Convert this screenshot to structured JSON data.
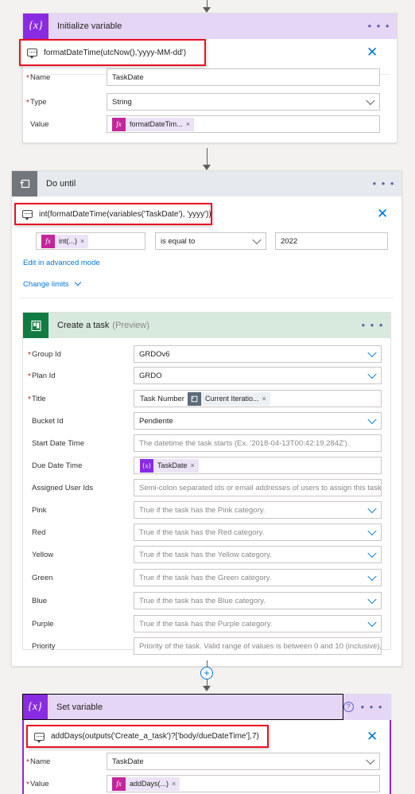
{
  "app": {
    "name": "Power Automate flow designer"
  },
  "steps": [
    {
      "id": "initialize-variable",
      "title": "Initialize variable",
      "subtitle": "",
      "icon": "variable-icon",
      "icon_glyph": "{x}",
      "header_color": "#e5d6f5",
      "icon_color": "#8a2be2",
      "formula_tooltip": "formatDateTime(utcNow(),'yyyy-MM-dd')",
      "params": [
        {
          "label": "Name",
          "required": true,
          "value": "TaskDate",
          "kind": "text"
        },
        {
          "label": "Type",
          "required": true,
          "value": "String",
          "kind": "dropdown"
        },
        {
          "label": "Value",
          "required": false,
          "value": "formatDateTim...",
          "kind": "token-fx"
        }
      ]
    },
    {
      "id": "do-until",
      "title": "Do until",
      "subtitle": "",
      "icon": "do-until-loop-icon",
      "header_color": "#e6eaef",
      "icon_color": "#72777e",
      "formula_tooltip": "int(formatDateTime(variables('TaskDate'), 'yyyy'))",
      "condition": {
        "left_token": "int(...)",
        "operator": "is equal to",
        "right_value": "2022"
      },
      "links": [
        {
          "label": "Edit in advanced mode",
          "chevron": false
        },
        {
          "label": "Change limits",
          "chevron": true
        }
      ]
    },
    {
      "id": "create-a-task",
      "title": "Create a task",
      "subtitle": "(Preview)",
      "icon": "planner-icon",
      "header_color": "#d8e9de",
      "icon_color": "#107c41",
      "params": [
        {
          "label": "Group Id",
          "required": true,
          "value": "GRDOv6",
          "kind": "dropdown",
          "placeholder": false
        },
        {
          "label": "Plan Id",
          "required": true,
          "value": "GRDO",
          "kind": "dropdown",
          "placeholder": false
        },
        {
          "label": "Title",
          "required": true,
          "value": "Task Number",
          "token": "Current Iteratio...",
          "kind": "text-plus-token"
        },
        {
          "label": "Bucket Id",
          "required": false,
          "value": "Pendiente",
          "kind": "dropdown",
          "placeholder": false
        },
        {
          "label": "Start Date Time",
          "required": false,
          "value": "The datetime the task starts (Ex. '2018-04-13T00:42:19.284Z').",
          "kind": "text",
          "placeholder": true
        },
        {
          "label": "Due Date Time",
          "required": false,
          "value": "TaskDate",
          "kind": "token-var"
        },
        {
          "label": "Assigned User Ids",
          "required": false,
          "value": "Semi-colon separated ids or email addresses of users to assign this task to.",
          "kind": "text",
          "placeholder": true
        },
        {
          "label": "Pink",
          "required": false,
          "value": "True if the task has the Pink category.",
          "kind": "dropdown",
          "placeholder": true
        },
        {
          "label": "Red",
          "required": false,
          "value": "True if the task has the Red category.",
          "kind": "dropdown",
          "placeholder": true
        },
        {
          "label": "Yellow",
          "required": false,
          "value": "True if the task has the Yellow category.",
          "kind": "dropdown",
          "placeholder": true
        },
        {
          "label": "Green",
          "required": false,
          "value": "True if the task has the Green category.",
          "kind": "dropdown",
          "placeholder": true
        },
        {
          "label": "Blue",
          "required": false,
          "value": "True if the task has the Blue category.",
          "kind": "dropdown",
          "placeholder": true
        },
        {
          "label": "Purple",
          "required": false,
          "value": "True if the task has the Purple category.",
          "kind": "dropdown",
          "placeholder": true
        },
        {
          "label": "Priority",
          "required": false,
          "value": "Priority of the task. Valid range of values is between 0 and 10 (inclusive), with in",
          "kind": "text",
          "placeholder": true
        }
      ]
    },
    {
      "id": "set-variable",
      "title": "Set variable",
      "subtitle": "",
      "icon": "variable-icon",
      "icon_glyph": "{x}",
      "header_color": "#e5d6f5",
      "icon_color": "#8a2be2",
      "formula_tooltip": "addDays(outputs('Create_a_task')?['body/dueDateTime'],7)",
      "params": [
        {
          "label": "Name",
          "required": true,
          "value": "TaskDate",
          "kind": "dropdown"
        },
        {
          "label": "Value",
          "required": true,
          "value": "addDays(...)",
          "kind": "token-fx"
        }
      ]
    }
  ],
  "icons": {
    "ellipsis": "• • •",
    "help": "?",
    "close": "✕",
    "plus": "+",
    "fx": "fx",
    "variable": "{x}"
  },
  "colors": {
    "canvas": "#f3f2f1",
    "accent_blue": "#0078d4",
    "highlight_red": "#e81123",
    "variable_purple": "#8a2be2",
    "planner_green": "#107c41",
    "fx_magenta": "#c2269b"
  }
}
